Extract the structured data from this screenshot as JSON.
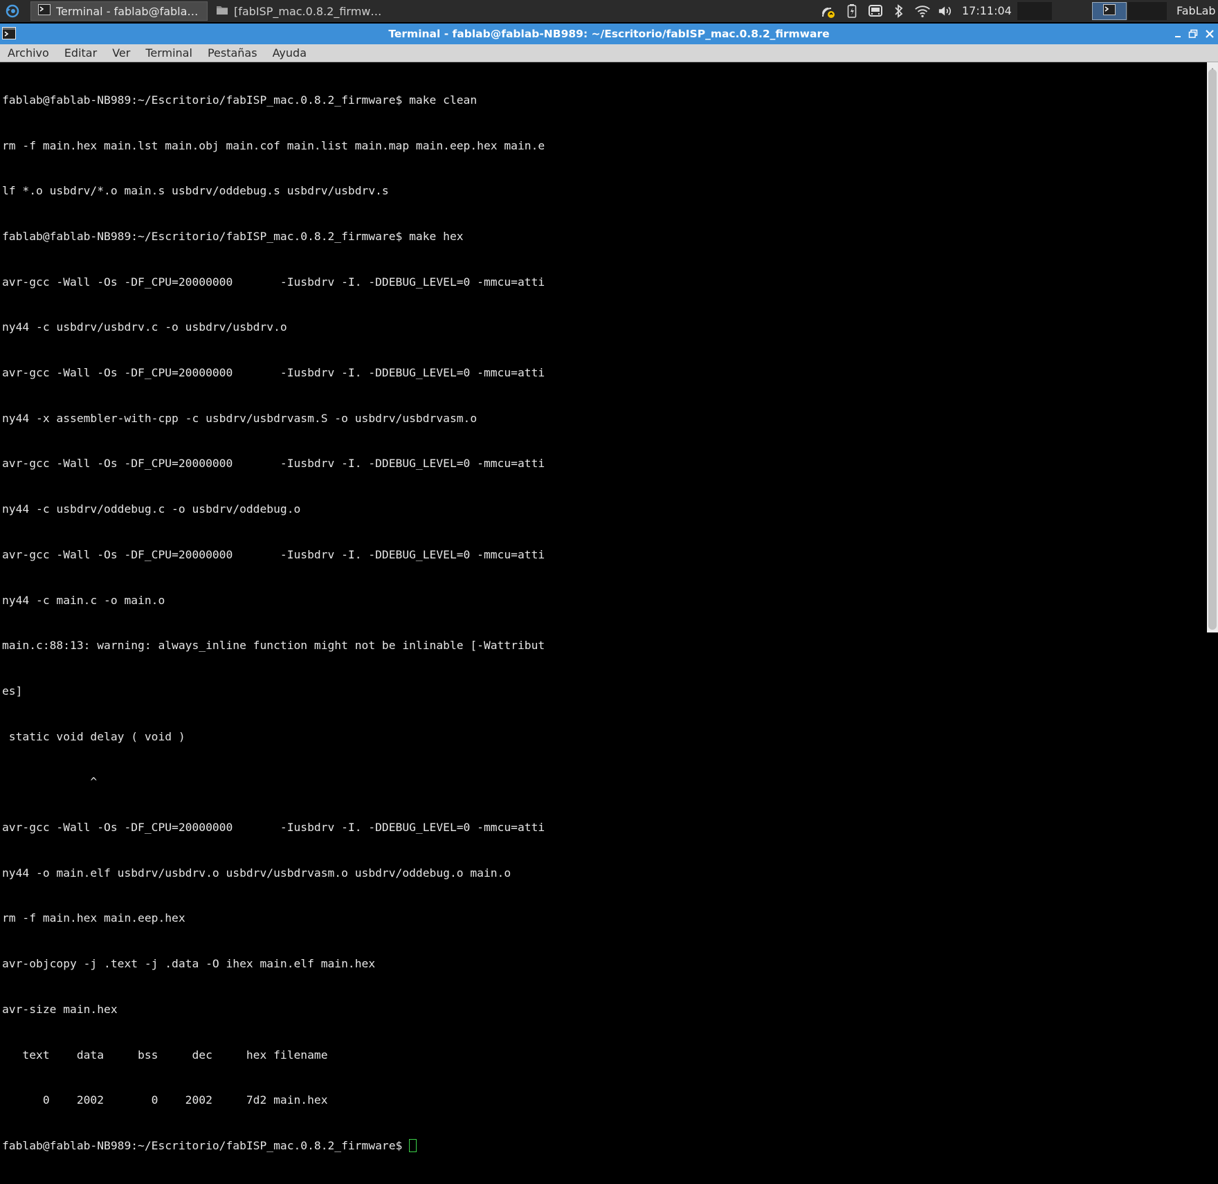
{
  "panel": {
    "tasks": [
      {
        "label": "Terminal - fablab@fablab-...",
        "icon": "terminal-icon",
        "active": true
      },
      {
        "label": "[fabISP_mac.0.8.2_firmwar...",
        "icon": "folder-icon",
        "active": false
      }
    ],
    "tray_icons": [
      "network-sync-icon",
      "battery-icon",
      "usb-device-icon",
      "bluetooth-icon",
      "wifi-icon",
      "volume-icon"
    ],
    "clock": "17:11:04",
    "user": "FabLab"
  },
  "window": {
    "title": "Terminal - fablab@fablab-NB989: ~/Escritorio/fabISP_mac.0.8.2_firmware",
    "titlebar_color": "#3d8fd8"
  },
  "menu": {
    "items": [
      "Archivo",
      "Editar",
      "Ver",
      "Terminal",
      "Pestañas",
      "Ayuda"
    ]
  },
  "terminal": {
    "lines": [
      "fablab@fablab-NB989:~/Escritorio/fabISP_mac.0.8.2_firmware$ make clean",
      "rm -f main.hex main.lst main.obj main.cof main.list main.map main.eep.hex main.e",
      "lf *.o usbdrv/*.o main.s usbdrv/oddebug.s usbdrv/usbdrv.s",
      "fablab@fablab-NB989:~/Escritorio/fabISP_mac.0.8.2_firmware$ make hex",
      "avr-gcc -Wall -Os -DF_CPU=20000000       -Iusbdrv -I. -DDEBUG_LEVEL=0 -mmcu=atti",
      "ny44 -c usbdrv/usbdrv.c -o usbdrv/usbdrv.o",
      "avr-gcc -Wall -Os -DF_CPU=20000000       -Iusbdrv -I. -DDEBUG_LEVEL=0 -mmcu=atti",
      "ny44 -x assembler-with-cpp -c usbdrv/usbdrvasm.S -o usbdrv/usbdrvasm.o",
      "avr-gcc -Wall -Os -DF_CPU=20000000       -Iusbdrv -I. -DDEBUG_LEVEL=0 -mmcu=atti",
      "ny44 -c usbdrv/oddebug.c -o usbdrv/oddebug.o",
      "avr-gcc -Wall -Os -DF_CPU=20000000       -Iusbdrv -I. -DDEBUG_LEVEL=0 -mmcu=atti",
      "ny44 -c main.c -o main.o",
      "main.c:88:13: warning: always_inline function might not be inlinable [-Wattribut",
      "es]",
      " static void delay ( void )",
      "             ^",
      "avr-gcc -Wall -Os -DF_CPU=20000000       -Iusbdrv -I. -DDEBUG_LEVEL=0 -mmcu=atti",
      "ny44 -o main.elf usbdrv/usbdrv.o usbdrv/usbdrvasm.o usbdrv/oddebug.o main.o",
      "rm -f main.hex main.eep.hex",
      "avr-objcopy -j .text -j .data -O ihex main.elf main.hex",
      "avr-size main.hex",
      "   text    data     bss     dec     hex filename",
      "      0    2002       0    2002     7d2 main.hex"
    ],
    "prompt": "fablab@fablab-NB989:~/Escritorio/fabISP_mac.0.8.2_firmware$",
    "cursor_color": "#3cd24a"
  }
}
